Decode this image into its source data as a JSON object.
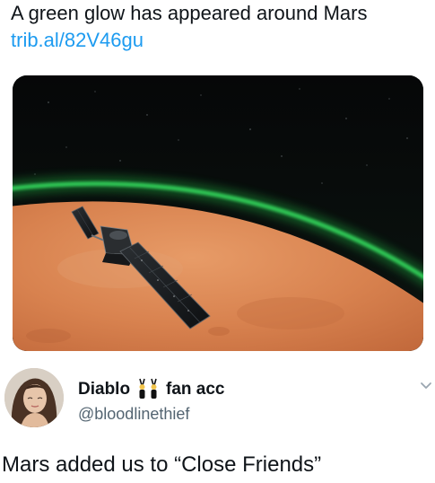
{
  "quoted": {
    "text": "A green glow has appeared around Mars",
    "link": "trib.al/82V46gu"
  },
  "media": {
    "icon": "mars-orbiter-image",
    "colors": {
      "space": "#050607",
      "mars": "#d8824f",
      "glow": "#27c64a"
    }
  },
  "author": {
    "display_name": "Diablo",
    "name_suffix": "fan acc",
    "emoji": "people-with-bunny-ears-icon",
    "handle": "@bloodlinethief"
  },
  "tweet": {
    "text": "Mars added us to “Close Friends”"
  },
  "colors": {
    "link": "#1d9bf0",
    "secondary_text": "#536471"
  }
}
